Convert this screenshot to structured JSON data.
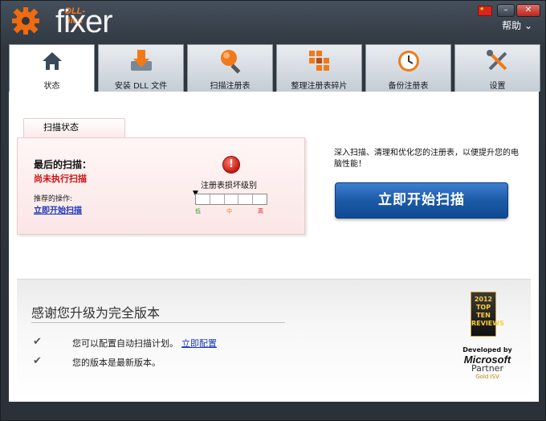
{
  "app": {
    "logo_small": "DLL-files",
    "logo_big": "fixer",
    "help_label": "帮助 ⌄"
  },
  "window_controls": {
    "minimize": "–",
    "close": "✕"
  },
  "tabs": [
    {
      "label": "状态",
      "icon": "home-icon",
      "active": true
    },
    {
      "label": "安装 DLL 文件",
      "icon": "download-icon",
      "active": false
    },
    {
      "label": "扫描注册表",
      "icon": "magnifier-icon",
      "active": false
    },
    {
      "label": "整理注册表碎片",
      "icon": "blocks-icon",
      "active": false
    },
    {
      "label": "备份注册表",
      "icon": "clock-backup-icon",
      "active": false
    },
    {
      "label": "设置",
      "icon": "tools-icon",
      "active": false
    }
  ],
  "status": {
    "tab_label": "扫描状态",
    "last_scan_label": "最后的扫描：",
    "last_scan_value": "尚未执行扫描",
    "recommended_label": "推荐的操作:",
    "recommended_link": "立即开始扫描",
    "damage_label": "注册表损坏级别",
    "levels": {
      "low": "低",
      "mid": "中",
      "high": "高"
    },
    "description": "深入扫描、清理和优化您的注册表，以便提升您的电脑性能！",
    "scan_button": "立即开始扫描"
  },
  "upgrade": {
    "title": "感谢您升级为完全版本",
    "features": [
      {
        "text": "您可以配置自动扫描计划。",
        "link": "立即配置"
      },
      {
        "text": "您的版本是最新版本。",
        "link": ""
      }
    ],
    "award_text": "2012 TOP TEN REVIEWS",
    "partner": {
      "developed_by": "Developed by",
      "name": "Microsoft",
      "partner": "Partner",
      "tier": "Gold ISV"
    }
  },
  "colors": {
    "accent": "#1c5aa6",
    "warning": "#d01010",
    "brand_orange": "#ff7a1a"
  }
}
